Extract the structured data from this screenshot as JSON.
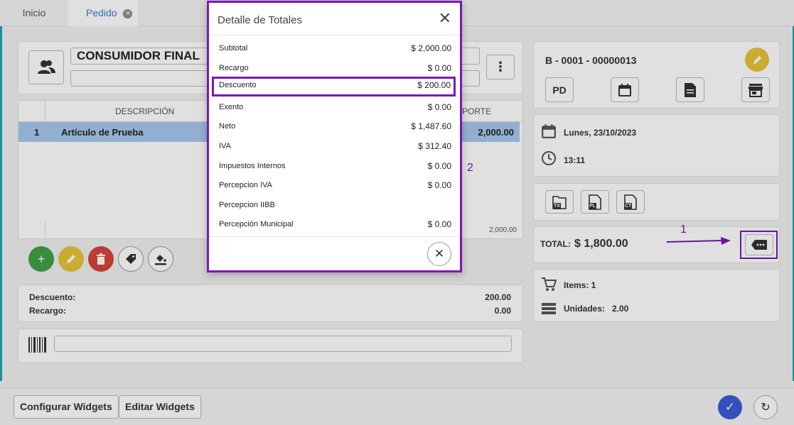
{
  "tabs": [
    {
      "label": "Inicio"
    },
    {
      "label": "Pedido"
    }
  ],
  "customer": {
    "name": "CONSUMIDOR FINAL"
  },
  "grid": {
    "headers": {
      "description": "DESCRIPCIÓN",
      "amount_partial": "PORTE"
    },
    "rows": [
      {
        "num": "1",
        "description": "Artículo de Prueba",
        "amount": "2,000.00"
      }
    ],
    "footer_total": "2,000.00"
  },
  "adjustments": {
    "discount_label": "Descuento:",
    "discount_value": "200.00",
    "surcharge_label": "Recargo:",
    "surcharge_value": "0.00"
  },
  "voucher": {
    "number": "B - 0001 - 00000013",
    "pd_label": "PD",
    "date": "Lunes, 23/10/2023",
    "time": "13:11",
    "doc_buttons": [
      "TX",
      "PL",
      "CT"
    ]
  },
  "totals_card": {
    "label": "TOTAL:",
    "value": "$ 1,800.00"
  },
  "counts": {
    "items_label": "Items: 1",
    "units_label": "Unidades:",
    "units_value": "2.00"
  },
  "bottom": {
    "config_widgets": "Configurar Widgets",
    "edit_widgets": "Editar Widgets"
  },
  "annotations": {
    "one": "1",
    "two": "2"
  },
  "modal": {
    "title": "Detalle de Totales",
    "rows": [
      {
        "label": "Subtotal",
        "value": "$ 2,000.00"
      },
      {
        "label": "Recargo",
        "value": "$ 0.00"
      },
      {
        "label": "Descuento",
        "value": "$ 200.00"
      },
      {
        "label": "Exento",
        "value": "$ 0.00"
      },
      {
        "label": "Neto",
        "value": "$ 1,487.60"
      },
      {
        "label": "IVA",
        "value": "$ 312.40"
      },
      {
        "label": "Impuestos Internos",
        "value": "$ 0.00"
      },
      {
        "label": "Percepcion IVA",
        "value": "$ 0.00"
      },
      {
        "label": "Percepcion IIBB",
        "value": ""
      },
      {
        "label": "Percepción Municipal",
        "value": "$ 0.00"
      }
    ]
  },
  "colors": {
    "accent": "#3b7bd6",
    "highlight": "#7a1ab0",
    "confirm": "#3d5bd9"
  }
}
